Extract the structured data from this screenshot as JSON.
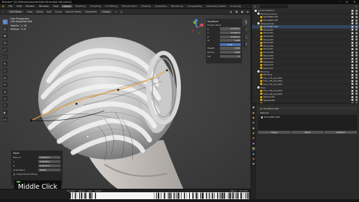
{
  "window": {
    "title": "Blender* [D:\\Patreon\\tutorials\\Hair\\Stranded hair.blend]",
    "controls": "– ☐ ✕"
  },
  "menu": {
    "items": [
      "File",
      "Edit",
      "Render",
      "Window",
      "Help"
    ],
    "workspaces": [
      "Layout",
      "Modeling",
      "Sculpting",
      "UV Editing",
      "Texture Paint",
      "Shading",
      "Animation",
      "Rendering",
      "Compositing",
      "Geometry Nodes",
      "Scripting"
    ],
    "active_workspace": "Layout",
    "scene": "Scene",
    "view_layer": "ViewLayer"
  },
  "header": {
    "mode": "Edit Mode",
    "items": [
      "View",
      "Select",
      "Add",
      "Curve",
      "Control Points",
      "Segments"
    ],
    "orientation": "Global"
  },
  "viewport": {
    "view_name": "User Perspective",
    "object_name": "(76) NurbsPath.006",
    "stats": [
      {
        "label": "Objects",
        "value": "1 / 18"
      },
      {
        "label": "Vertices",
        "value": "3 / 8"
      }
    ]
  },
  "tools": [
    "↖",
    "◎",
    "✥",
    "⟲",
    "⤢",
    "⬚",
    "✎",
    "⊹",
    "∠",
    "✂",
    "⊿",
    "≈",
    "⌇",
    "◐",
    "▭"
  ],
  "npanel": {
    "header": "Transform",
    "section": "Control Point:",
    "fields": [
      {
        "label": "X",
        "value": "-0.0435 m"
      },
      {
        "label": "Y",
        "value": "0.0393 m"
      },
      {
        "label": "Z",
        "value": "0.9978 m"
      },
      {
        "label": "W",
        "value": "1.000"
      },
      {
        "label": "",
        "value": "Local"
      },
      {
        "label": "Weight",
        "value": "1.000"
      },
      {
        "label": "Radius",
        "value": "1.000"
      },
      {
        "label": "Tilt",
        "value": "0°"
      }
    ],
    "tabs": [
      "Item",
      "Tool",
      "View",
      "Edit"
    ]
  },
  "redo_panel": {
    "title": "Move",
    "rows": [
      {
        "label": "Move X",
        "value": "0.00441 m"
      },
      {
        "label": "Y",
        "value": "0.00399 m"
      },
      {
        "label": "Z",
        "value": "0.00774 m"
      }
    ],
    "orientation_label": "Orientation",
    "orientation_value": "Global",
    "proportional_label": "Proportional Editing"
  },
  "overlay_label": "Middle Click",
  "timeline": {
    "controls": [
      "Playback",
      "Keying",
      "View",
      "Marker"
    ],
    "start": "Start 1",
    "end": "End 250"
  },
  "outliner": {
    "search_placeholder": "",
    "rows": [
      {
        "indent": 1,
        "name": "Scene Collection",
        "icon": "#dcdcdc",
        "extra": "",
        "sel": false
      },
      {
        "indent": 2,
        "name": "Blocking Curves",
        "icon": "#dcdcdc",
        "extra": "",
        "sel": false
      },
      {
        "indent": 3,
        "name": "NurbsPath.003",
        "icon": "#e0a800",
        "extra": "",
        "sel": false
      },
      {
        "indent": 3,
        "name": "NurbsPath.005",
        "icon": "#e0a800",
        "extra": "",
        "sel": false
      },
      {
        "indent": 2,
        "name": "Stranded hair",
        "icon": "#dcdcdc",
        "extra": "",
        "sel": false
      },
      {
        "indent": 3,
        "name": "NurbsPath.006",
        "icon": "#e0a800",
        "extra": "",
        "sel": true
      },
      {
        "indent": 3,
        "name": "Plane.001",
        "icon": "#e0a800",
        "extra": "",
        "sel": false
      },
      {
        "indent": 3,
        "name": "Plane.002",
        "icon": "#e0a800",
        "extra": "",
        "sel": false
      },
      {
        "indent": 3,
        "name": "Plane.003",
        "icon": "#e0a800",
        "extra": "",
        "sel": false
      },
      {
        "indent": 3,
        "name": "Plane.004",
        "icon": "#e0a800",
        "extra": "",
        "sel": false
      },
      {
        "indent": 3,
        "name": "Plane.005",
        "icon": "#e0a800",
        "extra": "",
        "sel": false
      },
      {
        "indent": 3,
        "name": "Plane.006",
        "icon": "#e0a800",
        "extra": "",
        "sel": false
      },
      {
        "indent": 3,
        "name": "Plane.007",
        "icon": "#e0a800",
        "extra": "",
        "sel": false
      },
      {
        "indent": 3,
        "name": "Plane.008",
        "icon": "#e0a800",
        "extra": "",
        "sel": false
      },
      {
        "indent": 3,
        "name": "Plane.009",
        "icon": "#e0a800",
        "extra": "",
        "sel": false
      },
      {
        "indent": 3,
        "name": "Plane.010",
        "icon": "#e0a800",
        "extra": "",
        "sel": false
      },
      {
        "indent": 3,
        "name": "Plane.011",
        "icon": "#e0a800",
        "extra": "",
        "sel": false
      },
      {
        "indent": 3,
        "name": "Plane.012",
        "icon": "#e0a800",
        "extra": "",
        "sel": false
      },
      {
        "indent": 3,
        "name": "Plane.013",
        "icon": "#e0a800",
        "extra": "",
        "sel": false
      },
      {
        "indent": 2,
        "name": "Blocking",
        "icon": "#dcdcdc",
        "extra": "",
        "sel": false
      },
      {
        "indent": 3,
        "name": "Blocking",
        "icon": "#e0a800",
        "extra": "",
        "sel": false
      },
      {
        "indent": 3,
        "name": "hair_cutt_pony.001",
        "icon": "#e0a800",
        "extra": "",
        "sel": false
      },
      {
        "indent": 3,
        "name": "hair_cutt_pony.002",
        "icon": "#e0a800",
        "extra": "",
        "sel": false
      },
      {
        "indent": 3,
        "name": "hair_cutt_pony.003",
        "icon": "#e0a800",
        "extra": "",
        "sel": false
      },
      {
        "indent": 2,
        "name": "Face",
        "icon": "#dcdcdc",
        "extra": "",
        "sel": false
      },
      {
        "indent": 3,
        "name": "hair_cutt_pony.004",
        "icon": "#e0a800",
        "extra": "",
        "sel": false
      },
      {
        "indent": 3,
        "name": "hair_cutt_pony.005",
        "icon": "#e0a800",
        "extra": "",
        "sel": false
      },
      {
        "indent": 3,
        "name": "Sphere.001",
        "icon": "#e0a800",
        "extra": "",
        "sel": false
      },
      {
        "indent": 3,
        "name": "Sphere.002",
        "icon": "#e0a800",
        "extra": "",
        "sel": false
      },
      {
        "indent": 3,
        "name": "Sphere.003",
        "icon": "#e0a800",
        "extra": "",
        "sel": false
      }
    ]
  },
  "properties": {
    "object": "NurbsPath.006",
    "section": "Material",
    "slots": [
      "NurbsPath.006"
    ],
    "buttons": [
      "Assign",
      "Select",
      "Deselect"
    ],
    "tab_colors": [
      "#d0d0d0",
      "#d89a3a",
      "#d89a3a",
      "#5b91d6",
      "#e0c050",
      "#5fae5f",
      "#d65b5b",
      "#b26fd6",
      "#d89a3a",
      "#5b91d6",
      "#d65b5b",
      "#7fbf7f"
    ]
  },
  "colors": {
    "accent": "#4872b4",
    "selection": "#33445c",
    "overlay_indicator": "#4cd14c"
  }
}
